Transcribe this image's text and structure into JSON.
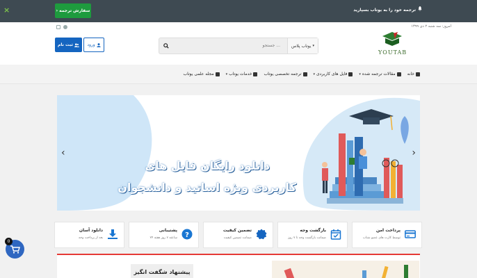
{
  "topbar": {
    "close_glyph": "×",
    "cta_label": "سفارش ترجمه",
    "cta_chevron": "›",
    "message": "ترجمه خود را به یوتاب بسپارید",
    "icons": [
      "bell-icon",
      "close-icon"
    ]
  },
  "header": {
    "date": "امروز: سه شنبه ۲ دی ۱۳۹۹",
    "logo_text": "YOUTAB",
    "search": {
      "select_label": "یوتاب پلاس",
      "placeholder": "جستجو ..."
    },
    "login_label": "ورود",
    "signup_label": "ثبت نام"
  },
  "nav": {
    "items": [
      {
        "label": "خانه",
        "icon": "home-icon",
        "dropdown": false
      },
      {
        "label": "مقالات ترجمه شده",
        "icon": "document-icon",
        "dropdown": true
      },
      {
        "label": "فایل های کاربردی",
        "icon": "file-icon",
        "dropdown": true
      },
      {
        "label": "ترجمه تخصصی یوتاب",
        "icon": "document-icon",
        "dropdown": false
      },
      {
        "label": "خدمات یوتاب",
        "icon": "grid-icon",
        "dropdown": true
      },
      {
        "label": "مجله علمی یوتاب",
        "icon": "edit-icon",
        "dropdown": false
      }
    ]
  },
  "hero": {
    "line1": "دانلود رایگان فایل های",
    "line2": "کاربردی ویژه اساتید و دانشجوان",
    "prev_glyph": "‹",
    "next_glyph": "›"
  },
  "features": [
    {
      "title": "دانلود آسان",
      "subtitle": "بعد از پرداخت وجه",
      "icon": "download-icon",
      "color": "#1976d2"
    },
    {
      "title": "پشتیبانی",
      "subtitle": "۲۴ ساعته ۷ روز هفته",
      "icon": "help-icon",
      "color": "#1976d2"
    },
    {
      "title": "تضمین کیفیت",
      "subtitle": "ضمانت تضمین کیفیت",
      "icon": "badge-icon",
      "color": "#1565c0"
    },
    {
      "title": "بازگشت وجه",
      "subtitle": "ضمانت بازگشت وجه تا ۷ روز",
      "icon": "calendar-check-icon",
      "color": "#1976d2"
    },
    {
      "title": "پرداخت امن",
      "subtitle": "توسط کارت های عضو شتاب",
      "icon": "credit-card-icon",
      "color": "#1976d2"
    }
  ],
  "bottom": {
    "tag": "پیشنهاد شگفت انگیز"
  },
  "cart": {
    "count": "0",
    "icon": "cart-icon"
  },
  "colors": {
    "topbar": "#3e4a52",
    "cta": "#1e9b3e",
    "primary": "#1565c0",
    "accent_red": "#e53935"
  }
}
